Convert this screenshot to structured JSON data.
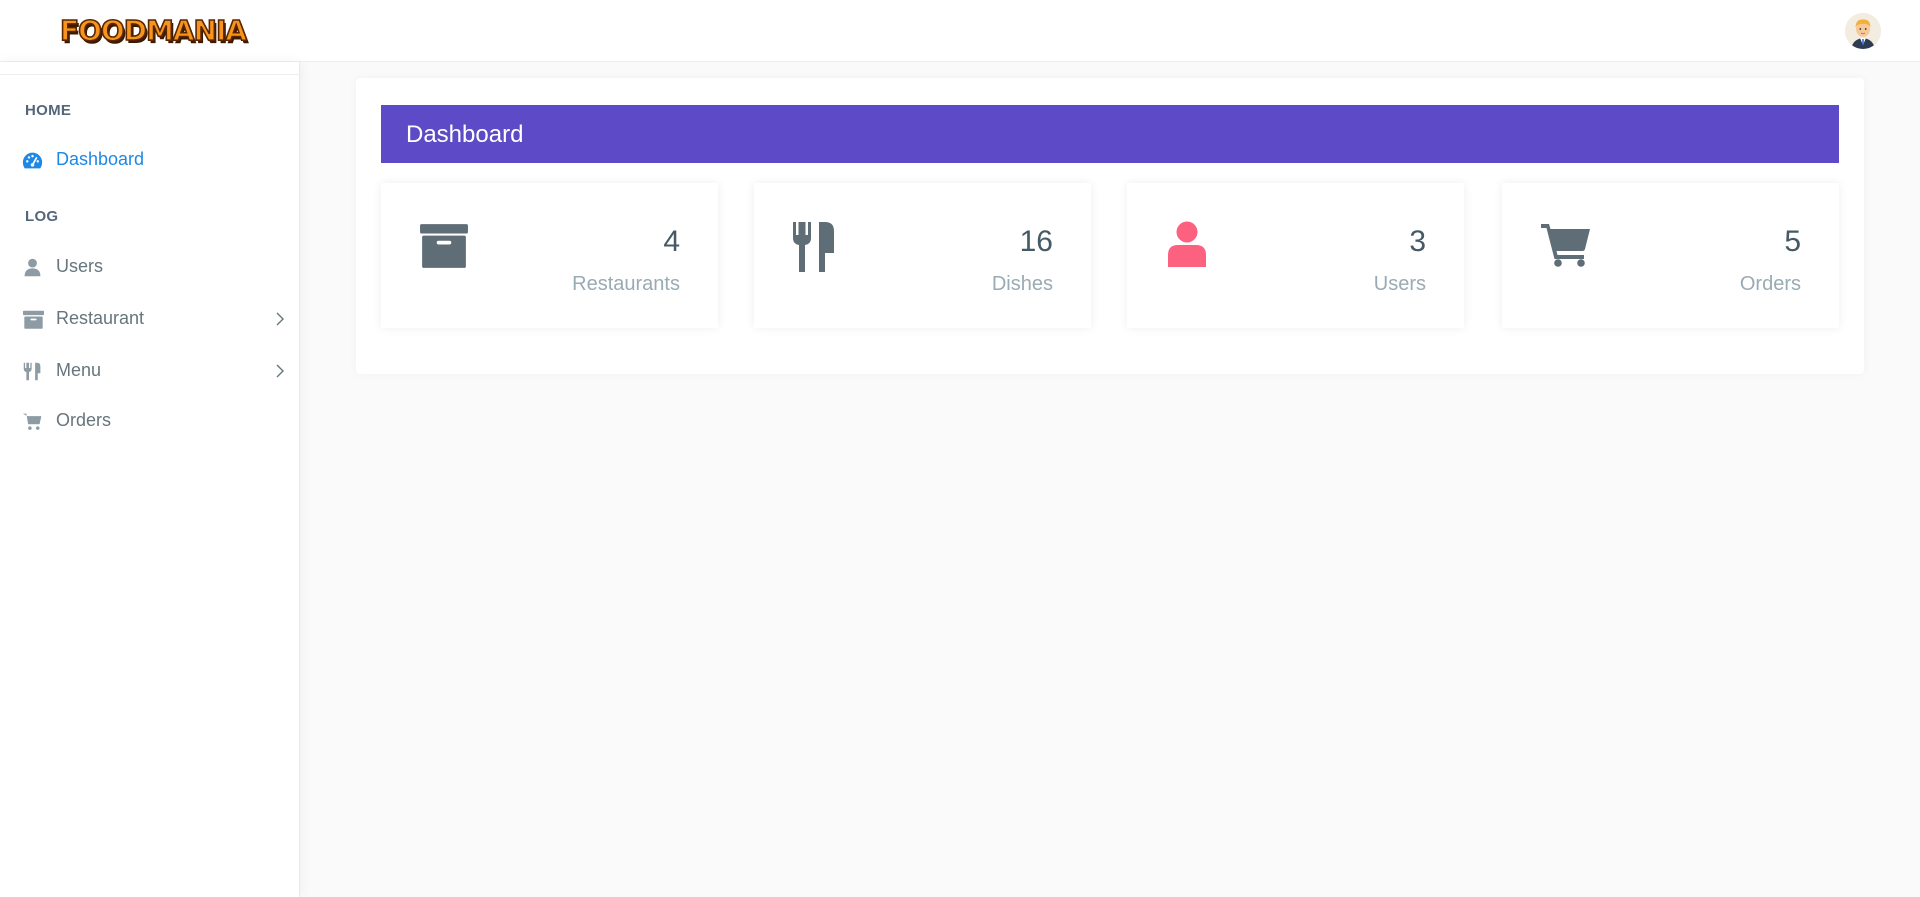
{
  "brand": {
    "logo_text": "FOODMANIA",
    "logo_color": "#f7941d"
  },
  "header": {
    "avatar_icon": "user-avatar"
  },
  "sidebar": {
    "sections": [
      {
        "heading": "HOME"
      },
      {
        "heading": "LOG"
      }
    ],
    "items": [
      {
        "label": "Dashboard",
        "icon": "dashboard-gauge-icon",
        "active": true,
        "has_submenu": false
      },
      {
        "label": "Users",
        "icon": "user-icon",
        "active": false,
        "has_submenu": false
      },
      {
        "label": "Restaurant",
        "icon": "archive-box-icon",
        "active": false,
        "has_submenu": true
      },
      {
        "label": "Menu",
        "icon": "utensils-icon",
        "active": false,
        "has_submenu": true
      },
      {
        "label": "Orders",
        "icon": "shopping-cart-icon",
        "active": false,
        "has_submenu": false
      }
    ],
    "active_color": "#1e88e5"
  },
  "main": {
    "title": "Dashboard",
    "header_color": "#5c4ac7",
    "stats": [
      {
        "count": "4",
        "label": "Restaurants",
        "icon": "archive-box-icon",
        "icon_color": "#5f6d76"
      },
      {
        "count": "16",
        "label": "Dishes",
        "icon": "utensils-icon",
        "icon_color": "#5f6d76"
      },
      {
        "count": "3",
        "label": "Users",
        "icon": "user-icon",
        "icon_color": "#fc6180"
      },
      {
        "count": "5",
        "label": "Orders",
        "icon": "shopping-cart-icon",
        "icon_color": "#5f6d76"
      }
    ]
  }
}
